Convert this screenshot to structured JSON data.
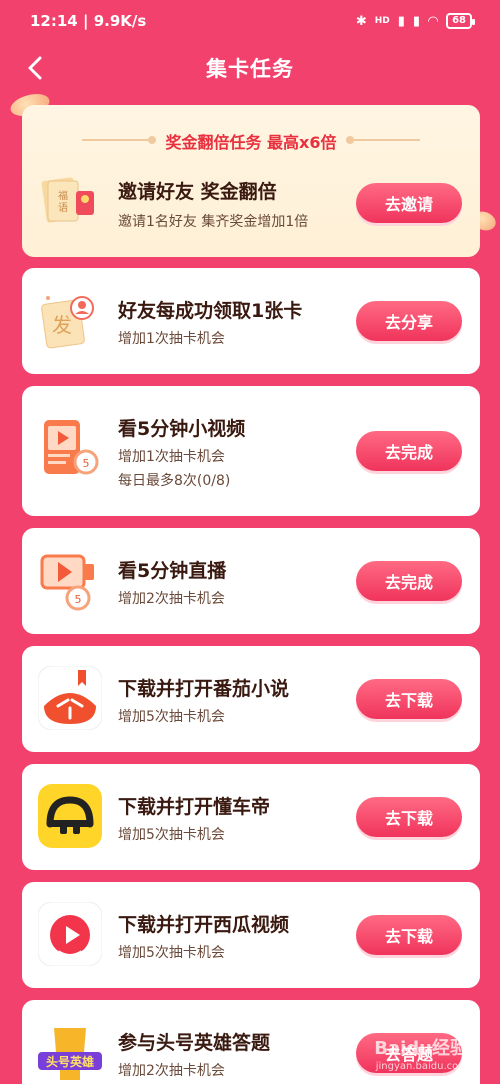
{
  "status_bar": {
    "time": "12:14",
    "speed": "9.9K/s",
    "network": "HD",
    "battery": "68"
  },
  "header": {
    "title": "集卡任务"
  },
  "banner": {
    "headline": "奖金翻倍任务 最高x6倍",
    "title": "邀请好友 奖金翻倍",
    "subtitle": "邀请1名好友 集齐奖金增加1倍",
    "button": "去邀请"
  },
  "tasks": [
    {
      "title": "好友每成功领取1张卡",
      "sub1": "增加1次抽卡机会",
      "sub2": "",
      "button": "去分享",
      "icon": "fa-card-friend-icon"
    },
    {
      "title": "看5分钟小视频",
      "sub1": "增加1次抽卡机会",
      "sub2": "每日最多8次(0/8)",
      "button": "去完成",
      "icon": "video-timer-icon"
    },
    {
      "title": "看5分钟直播",
      "sub1": "增加2次抽卡机会",
      "sub2": "",
      "button": "去完成",
      "icon": "live-timer-icon"
    },
    {
      "title": "下载并打开番茄小说",
      "sub1": "增加5次抽卡机会",
      "sub2": "",
      "button": "去下载",
      "icon": "tomato-novel-app-icon"
    },
    {
      "title": "下载并打开懂车帝",
      "sub1": "增加5次抽卡机会",
      "sub2": "",
      "button": "去下载",
      "icon": "dongchedi-app-icon"
    },
    {
      "title": "下载并打开西瓜视频",
      "sub1": "增加5次抽卡机会",
      "sub2": "",
      "button": "去下载",
      "icon": "xigua-video-app-icon"
    },
    {
      "title": "参与头号英雄答题",
      "sub1": "增加2次抽卡机会",
      "sub2": "",
      "button": "去答题",
      "icon": "toutiao-hero-trophy-icon"
    }
  ],
  "watermark": {
    "line1": "Baidu经验",
    "line2": "jingyan.baidu.com"
  }
}
